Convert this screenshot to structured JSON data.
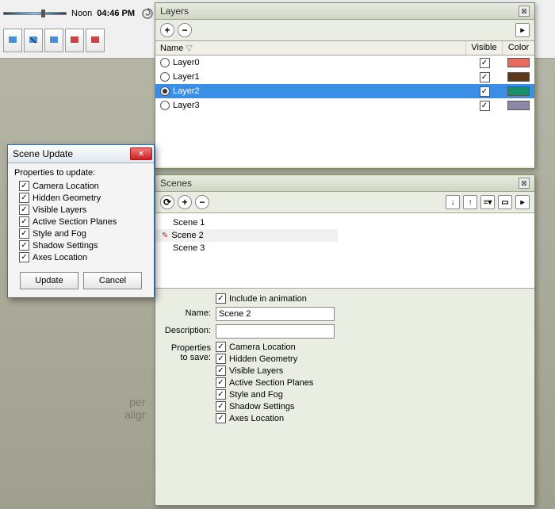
{
  "toolbar": {
    "noon_label": "Noon",
    "time_label": "04:46 PM"
  },
  "layers_panel": {
    "title": "Layers",
    "headers": {
      "name": "Name",
      "visible": "Visible",
      "color": "Color"
    },
    "rows": [
      {
        "name": "Layer0",
        "visible": true,
        "selected": false,
        "radio": false,
        "color": "#e96a5f"
      },
      {
        "name": "Layer1",
        "visible": true,
        "selected": false,
        "radio": false,
        "color": "#5a3a1a"
      },
      {
        "name": "Layer2",
        "visible": true,
        "selected": true,
        "radio": true,
        "color": "#178f6a"
      },
      {
        "name": "Layer3",
        "visible": true,
        "selected": false,
        "radio": false,
        "color": "#8a8aa8"
      }
    ]
  },
  "scenes_panel": {
    "title": "Scenes",
    "list": [
      {
        "label": "Scene 1",
        "active": false
      },
      {
        "label": "Scene 2",
        "active": true
      },
      {
        "label": "Scene 3",
        "active": false
      }
    ],
    "include_label": "Include in animation",
    "include_checked": true,
    "name_label": "Name:",
    "name_value": "Scene 2",
    "description_label": "Description:",
    "description_value": "",
    "props_label_1": "Properties",
    "props_label_2": "to save:",
    "props": [
      {
        "label": "Camera Location",
        "checked": true
      },
      {
        "label": "Hidden Geometry",
        "checked": true
      },
      {
        "label": "Visible Layers",
        "checked": true
      },
      {
        "label": "Active Section Planes",
        "checked": true
      },
      {
        "label": "Style and Fog",
        "checked": true
      },
      {
        "label": "Shadow Settings",
        "checked": true
      },
      {
        "label": "Axes Location",
        "checked": true
      }
    ]
  },
  "dialog": {
    "title": "Scene Update",
    "heading": "Properties to update:",
    "props": [
      {
        "label": "Camera Location",
        "checked": true
      },
      {
        "label": "Hidden Geometry",
        "checked": true
      },
      {
        "label": "Visible Layers",
        "checked": true
      },
      {
        "label": "Active Section Planes",
        "checked": true
      },
      {
        "label": "Style and Fog",
        "checked": true
      },
      {
        "label": "Shadow Settings",
        "checked": true
      },
      {
        "label": "Axes Location",
        "checked": true
      }
    ],
    "update_btn": "Update",
    "cancel_btn": "Cancel"
  },
  "bg": {
    "line1": "per",
    "line2": "aligr"
  }
}
